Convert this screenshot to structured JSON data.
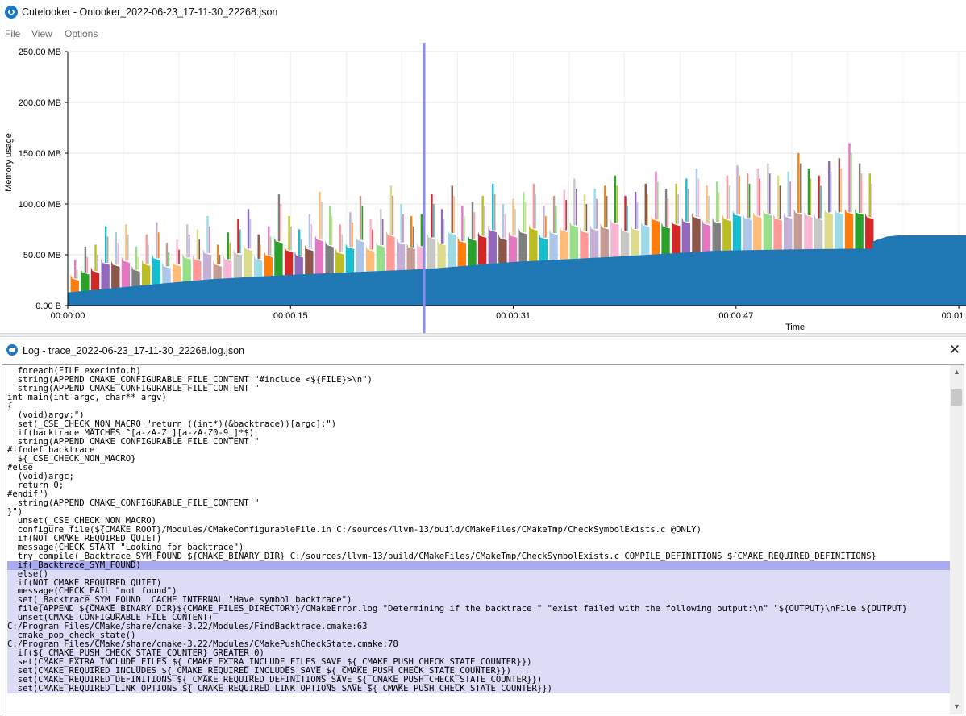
{
  "window": {
    "title": "Cutelooker - Onlooker_2022-06-23_17-11-30_22268.json",
    "icon": "eye-icon"
  },
  "menu": [
    "File",
    "View",
    "Options"
  ],
  "chart_data": {
    "type": "area",
    "title": "",
    "xlabel": "Time",
    "ylabel": "Memory usage",
    "x_ticks": [
      "00:00:00",
      "00:00:15",
      "00:00:31",
      "00:00:47",
      "00:01:02"
    ],
    "y_ticks": [
      "0.00 B",
      "50.00 MB",
      "100.00 MB",
      "150.00 MB",
      "200.00 MB",
      "250.00 MB"
    ],
    "xlim_seconds": [
      0,
      62.5
    ],
    "ylim_mb": [
      0,
      250
    ],
    "cursor_time_seconds": 24.8,
    "base_series": {
      "name": "base",
      "color": "#1f77b4",
      "points": [
        [
          0,
          13
        ],
        [
          3,
          17
        ],
        [
          6,
          21
        ],
        [
          10,
          26
        ],
        [
          15,
          30
        ],
        [
          20,
          33
        ],
        [
          25,
          36
        ],
        [
          31,
          43
        ],
        [
          38,
          48
        ],
        [
          45,
          54
        ],
        [
          51,
          55.5
        ],
        [
          54.5,
          56
        ],
        [
          56,
          56
        ],
        [
          56,
          63
        ],
        [
          57,
          68
        ],
        [
          57.8,
          69
        ],
        [
          62.5,
          69
        ]
      ]
    },
    "spike_peaks_mb": [
      45,
      58,
      60,
      78,
      72,
      80,
      58,
      70,
      82,
      62,
      65,
      80,
      75,
      88,
      60,
      72,
      85,
      95,
      70,
      78,
      110,
      88,
      75,
      90,
      112,
      98,
      80,
      92,
      108,
      85,
      95,
      118,
      100,
      88,
      90,
      110,
      95,
      118,
      98,
      102,
      108,
      120,
      100,
      105,
      112,
      120,
      98,
      108,
      114,
      125,
      110,
      115,
      118,
      128,
      108,
      112,
      120,
      132,
      115,
      120,
      125,
      135,
      118,
      122,
      128,
      138,
      130,
      135,
      140,
      128,
      132,
      150,
      135,
      128,
      142,
      145,
      160,
      140,
      130
    ],
    "spike_colors": [
      "#ff7f0e",
      "#2ca02c",
      "#d62728",
      "#9467bd",
      "#8c564b",
      "#e377c2",
      "#7f7f7f",
      "#bcbd22",
      "#17becf",
      "#aec7e8",
      "#ffbb78",
      "#98df8a",
      "#ff9896",
      "#c5b0d5",
      "#c49c94",
      "#f7b6d2",
      "#c7c7c7",
      "#dbdb8d",
      "#9edae5"
    ]
  },
  "log": {
    "title": "Log - trace_2022-06-23_17-11-30_22268.log.json",
    "icon": "eye-icon",
    "close_icon": "close-icon",
    "selected_line_index": 22,
    "highlight_from_index": 22,
    "lines": [
      "  foreach(FILE execinfo.h)",
      "  string(APPEND CMAKE_CONFIGURABLE_FILE_CONTENT \"#include <${FILE}>\\n\")",
      "  string(APPEND CMAKE_CONFIGURABLE_FILE_CONTENT \"",
      "int main(int argc, char** argv)",
      "{",
      "  (void)argv;\")",
      "  set(_CSE_CHECK_NON_MACRO \"return ((int*)(&backtrace))[argc];\")",
      "  if(backtrace MATCHES ^[a-zA-Z_][a-zA-Z0-9_]*$)",
      "  string(APPEND CMAKE_CONFIGURABLE_FILE_CONTENT \"",
      "#ifndef backtrace",
      "  ${_CSE_CHECK_NON_MACRO}",
      "#else",
      "  (void)argc;",
      "  return 0;",
      "#endif\")",
      "  string(APPEND CMAKE_CONFIGURABLE_FILE_CONTENT \"",
      "}\")",
      "  unset(_CSE_CHECK_NON_MACRO)",
      "  configure_file(${CMAKE_ROOT}/Modules/CMakeConfigurableFile.in C:/sources/llvm-13/build/CMakeFiles/CMakeTmp/CheckSymbolExists.c @ONLY)",
      "  if(NOT CMAKE_REQUIRED_QUIET)",
      "  message(CHECK_START \"Looking for backtrace\")",
      "  try_compile(_Backtrace_SYM_FOUND ${CMAKE_BINARY_DIR} C:/sources/llvm-13/build/CMakeFiles/CMakeTmp/CheckSymbolExists.c COMPILE_DEFINITIONS ${CMAKE_REQUIRED_DEFINITIONS}",
      "  if(_Backtrace_SYM_FOUND)",
      "  else()",
      "  if(NOT CMAKE_REQUIRED_QUIET)",
      "  message(CHECK_FAIL \"not found\")",
      "  set(_Backtrace_SYM_FOUND  CACHE INTERNAL \"Have symbol backtrace\")",
      "  file(APPEND ${CMAKE_BINARY_DIR}${CMAKE_FILES_DIRECTORY}/CMakeError.log \"Determining if the backtrace \" \"exist failed with the following output:\\n\" \"${OUTPUT}\\nFile ${OUTPUT}",
      "  unset(CMAKE_CONFIGURABLE_FILE_CONTENT)",
      "C:/Program Files/CMake/share/cmake-3.22/Modules/FindBacktrace.cmake:63",
      "  cmake_pop_check_state()",
      "C:/Program Files/CMake/share/cmake-3.22/Modules/CMakePushCheckState.cmake:78",
      "  if(${_CMAKE_PUSH_CHECK_STATE_COUNTER} GREATER 0)",
      "  set(CMAKE_EXTRA_INCLUDE_FILES ${_CMAKE_EXTRA_INCLUDE_FILES_SAVE_${_CMAKE_PUSH_CHECK_STATE_COUNTER}})",
      "  set(CMAKE_REQUIRED_INCLUDES ${_CMAKE_REQUIRED_INCLUDES_SAVE_${_CMAKE_PUSH_CHECK_STATE_COUNTER}})",
      "  set(CMAKE_REQUIRED_DEFINITIONS ${_CMAKE_REQUIRED_DEFINITIONS_SAVE_${_CMAKE_PUSH_CHECK_STATE_COUNTER}})",
      "  set(CMAKE_REQUIRED_LINK_OPTIONS ${_CMAKE_REQUIRED_LINK_OPTIONS_SAVE_${_CMAKE_PUSH_CHECK_STATE_COUNTER}})"
    ]
  }
}
